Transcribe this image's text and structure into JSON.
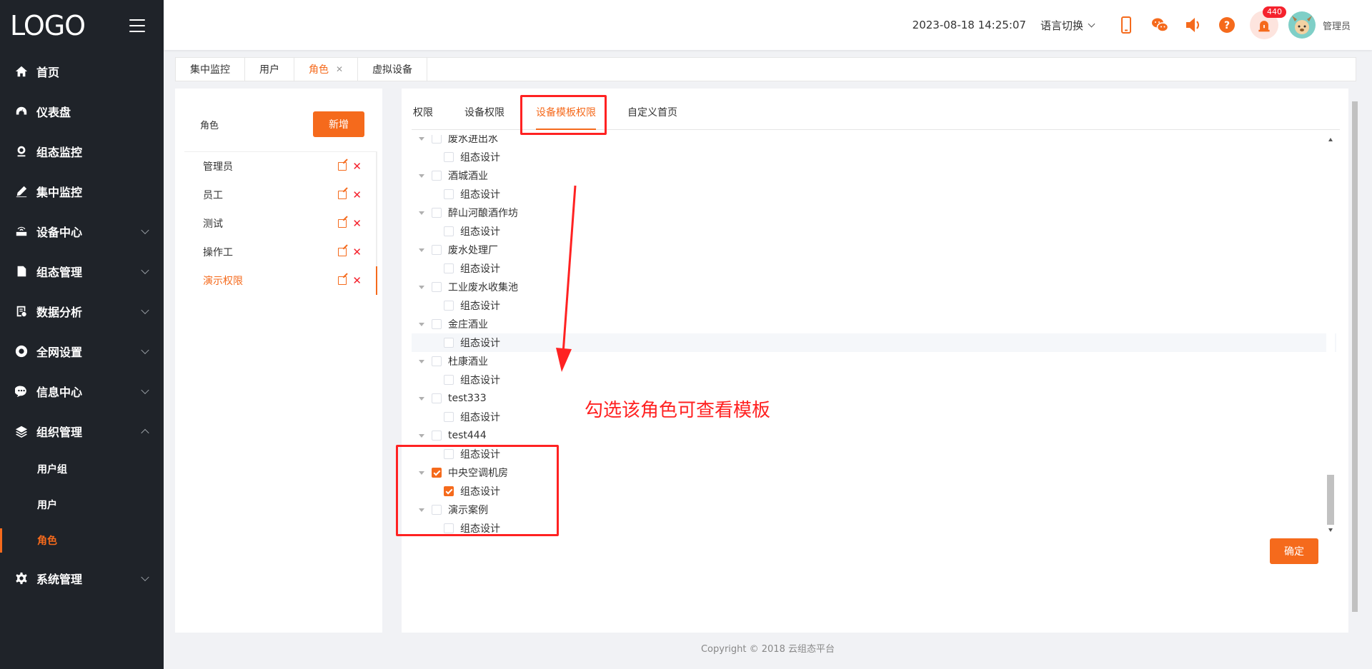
{
  "sidebar": {
    "logo": "LOGO",
    "menu": [
      {
        "label": "首页",
        "icon": "home-icon",
        "has_children": false
      },
      {
        "label": "仪表盘",
        "icon": "dashboard-icon",
        "has_children": false
      },
      {
        "label": "组态监控",
        "icon": "camera-icon",
        "has_children": false
      },
      {
        "label": "集中监控",
        "icon": "pen-icon",
        "has_children": false
      },
      {
        "label": "设备中心",
        "icon": "router-icon",
        "has_children": true
      },
      {
        "label": "组态管理",
        "icon": "document-icon",
        "has_children": true
      },
      {
        "label": "数据分析",
        "icon": "report-icon",
        "has_children": true
      },
      {
        "label": "全网设置",
        "icon": "circle-settings-icon",
        "has_children": true
      },
      {
        "label": "信息中心",
        "icon": "message-icon",
        "has_children": true
      },
      {
        "label": "组织管理",
        "icon": "layers-icon",
        "has_children": true,
        "expanded": true
      },
      {
        "label": "系统管理",
        "icon": "gear-icon",
        "has_children": true
      }
    ],
    "org_submenu": [
      {
        "label": "用户组",
        "active": false
      },
      {
        "label": "用户",
        "active": false
      },
      {
        "label": "角色",
        "active": true
      }
    ]
  },
  "header": {
    "datetime": "2023-08-18 14:25:07",
    "language_switch": "语言切换",
    "alarm_count": "440",
    "username": "管理员"
  },
  "tabs": [
    {
      "label": "集中监控",
      "active": false
    },
    {
      "label": "用户",
      "active": false
    },
    {
      "label": "角色",
      "active": true,
      "closable": true
    },
    {
      "label": "虚拟设备",
      "active": false
    }
  ],
  "roles_panel": {
    "title": "角色",
    "add_button": "新增",
    "roles": [
      {
        "name": "管理员",
        "active": false
      },
      {
        "name": "员工",
        "active": false
      },
      {
        "name": "测试",
        "active": false
      },
      {
        "name": "操作工",
        "active": false
      },
      {
        "name": "演示权限",
        "active": true
      }
    ]
  },
  "permission_tabs": [
    {
      "label": "权限",
      "active": false
    },
    {
      "label": "设备权限",
      "active": false
    },
    {
      "label": "设备模板权限",
      "active": true
    },
    {
      "label": "自定义首页",
      "active": false
    }
  ],
  "template_tree": [
    {
      "name": "废水进出水",
      "checked": false,
      "children": [
        {
          "name": "组态设计",
          "checked": false
        }
      ]
    },
    {
      "name": "酒城酒业",
      "checked": false,
      "children": [
        {
          "name": "组态设计",
          "checked": false
        }
      ]
    },
    {
      "name": "醉山河酿酒作坊",
      "checked": false,
      "children": [
        {
          "name": "组态设计",
          "checked": false
        }
      ]
    },
    {
      "name": "废水处理厂",
      "checked": false,
      "children": [
        {
          "name": "组态设计",
          "checked": false
        }
      ]
    },
    {
      "name": "工业废水收集池",
      "checked": false,
      "children": [
        {
          "name": "组态设计",
          "checked": false
        }
      ]
    },
    {
      "name": "金庄酒业",
      "checked": false,
      "children": [
        {
          "name": "组态设计",
          "checked": false,
          "highlighted": true
        }
      ]
    },
    {
      "name": "杜康酒业",
      "checked": false,
      "children": [
        {
          "name": "组态设计",
          "checked": false
        }
      ]
    },
    {
      "name": "test333",
      "checked": false,
      "children": [
        {
          "name": "组态设计",
          "checked": false
        }
      ]
    },
    {
      "name": "test444",
      "checked": false,
      "children": [
        {
          "name": "组态设计",
          "checked": false
        }
      ]
    },
    {
      "name": "中央空调机房",
      "checked": true,
      "children": [
        {
          "name": "组态设计",
          "checked": true
        }
      ]
    },
    {
      "name": "演示案例",
      "checked": false,
      "children": [
        {
          "name": "组态设计",
          "checked": false
        }
      ]
    }
  ],
  "confirm_button": "确定",
  "annotation": "勾选该角色可查看模板",
  "footer": "Copyright © 2018 云组态平台",
  "colors": {
    "accent": "#f56a1c",
    "sidebar_bg": "#1f2329",
    "annotation_red": "#ff2222"
  }
}
